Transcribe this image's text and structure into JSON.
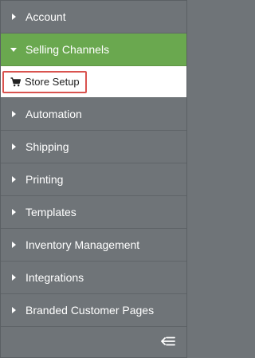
{
  "sidebar": {
    "items": [
      {
        "label": "Account",
        "expanded": false
      },
      {
        "label": "Selling Channels",
        "expanded": true
      },
      {
        "label": "Automation",
        "expanded": false
      },
      {
        "label": "Shipping",
        "expanded": false
      },
      {
        "label": "Printing",
        "expanded": false
      },
      {
        "label": "Templates",
        "expanded": false
      },
      {
        "label": "Inventory Management",
        "expanded": false
      },
      {
        "label": "Integrations",
        "expanded": false
      },
      {
        "label": "Branded Customer Pages",
        "expanded": false
      }
    ],
    "subitems": {
      "selling_channels": [
        {
          "label": "Store Setup",
          "icon": "cart-icon",
          "highlighted": true
        }
      ]
    },
    "footer": {
      "collapse_icon": "collapse-sidebar-icon"
    }
  },
  "colors": {
    "sidebar_bg": "#6f7478",
    "active_bg": "#6aa84f",
    "highlight_border": "#d9534f",
    "text": "#ffffff"
  }
}
